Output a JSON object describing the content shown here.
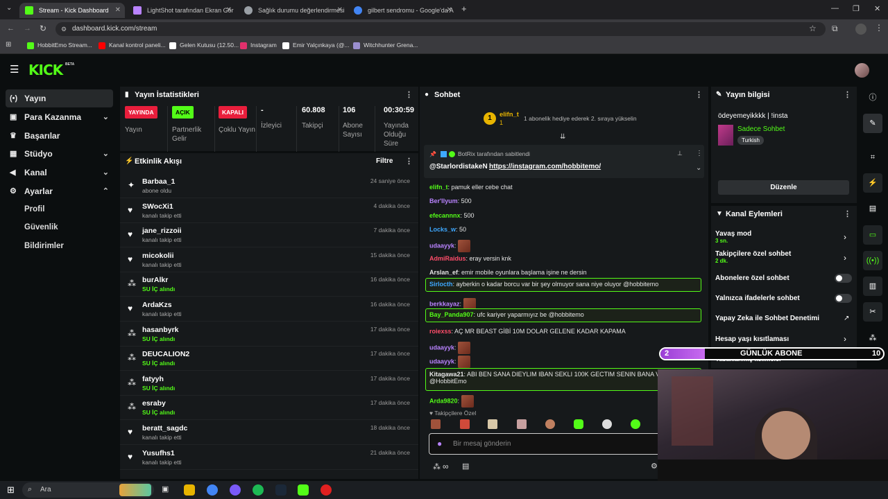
{
  "browser": {
    "tabs": [
      {
        "title": "Stream - Kick Dashboard",
        "color": "#53fc18"
      },
      {
        "title": "LightShot tarafından Ekran Gör",
        "color": "#b983ff"
      },
      {
        "title": "Sağlık durumu değerlendirmesi",
        "color": "#9aa0a6"
      },
      {
        "title": "gilbert sendromu - Google'da A",
        "color": "#4285f4"
      }
    ],
    "url": "dashboard.kick.com/stream",
    "bookmarks": [
      {
        "label": "HobbitEmo Stream...",
        "color": "#53fc18"
      },
      {
        "label": "Kanal kontrol paneli...",
        "color": "#ff0000"
      },
      {
        "label": "Gelen Kutusu (12.50...",
        "color": "#ffffff"
      },
      {
        "label": "Instagram",
        "color": "#e1306c"
      },
      {
        "label": "Emir Yalçınkaya (@...",
        "color": "#ffffff"
      },
      {
        "label": "Witchhunter Grena...",
        "color": "#9b8fd0"
      }
    ]
  },
  "header": {
    "logo": "KICK",
    "beta": "BETA"
  },
  "sidebar": {
    "items": [
      {
        "label": "Yayın",
        "icon": "broadcast-icon"
      },
      {
        "label": "Para Kazanma",
        "icon": "money-icon"
      },
      {
        "label": "Başarılar",
        "icon": "trophy-icon"
      },
      {
        "label": "Stüdyo",
        "icon": "studio-icon"
      },
      {
        "label": "Kanal",
        "icon": "channel-icon"
      },
      {
        "label": "Ayarlar",
        "icon": "settings-icon"
      }
    ],
    "sub_items": [
      "Profil",
      "Güvenlik",
      "Bildirimler"
    ]
  },
  "stats": {
    "title": "Yayın İstatistikleri",
    "cells": [
      {
        "badge": "YAYINDA",
        "label": "Yayın"
      },
      {
        "badge": "AÇIK",
        "label": "Partnerlik Gelir"
      },
      {
        "badge": "KAPALI",
        "label": "Çoklu Yayın"
      },
      {
        "value": "-",
        "label": "İzleyici"
      },
      {
        "value": "60.808",
        "label": "Takipçi"
      },
      {
        "value": "106",
        "label": "Abone Sayısı"
      },
      {
        "value": "00:30:59",
        "label": "Yayında Olduğu Süre"
      }
    ]
  },
  "activity": {
    "title": "Etkinlik Akışı",
    "filter": "Filtre",
    "items": [
      {
        "name": "Barbaa_1",
        "desc": "abone oldu",
        "time": "24 saniye önce",
        "type": "sub"
      },
      {
        "name": "SWocXi1",
        "desc": "kanalı takip etti",
        "time": "4 dakika önce",
        "type": "follow"
      },
      {
        "name": "jane_rizzoii",
        "desc": "kanalı takip etti",
        "time": "7 dakika önce",
        "type": "follow"
      },
      {
        "name": "micokolii",
        "desc": "kanalı takip etti",
        "time": "15 dakika önce",
        "type": "follow"
      },
      {
        "name": "burAlkr",
        "desc": "SU İÇ alındı",
        "time": "16 dakika önce",
        "type": "reward"
      },
      {
        "name": "ArdaKzs",
        "desc": "kanalı takip etti",
        "time": "16 dakika önce",
        "type": "follow"
      },
      {
        "name": "hasanbyrk",
        "desc": "SU İÇ alındı",
        "time": "17 dakika önce",
        "type": "reward"
      },
      {
        "name": "DEUCALION2",
        "desc": "SU İÇ alındı",
        "time": "17 dakika önce",
        "type": "reward"
      },
      {
        "name": "fatyyh",
        "desc": "SU İÇ alındı",
        "time": "17 dakika önce",
        "type": "reward"
      },
      {
        "name": "esraby",
        "desc": "SU İÇ alındı",
        "time": "17 dakika önce",
        "type": "reward"
      },
      {
        "name": "beratt_sagdc",
        "desc": "kanalı takip etti",
        "time": "18 dakika önce",
        "type": "follow"
      },
      {
        "name": "Yusufhs1",
        "desc": "kanalı takip etti",
        "time": "21 dakika önce",
        "type": "follow"
      }
    ]
  },
  "chat": {
    "title": "Sohbet",
    "top_gifter": "elifn_t",
    "top_gifter_count": "1",
    "gift_text": "1 abonelik hediye ederek 2. sıraya yükselin",
    "pinned_by": "BotRix tarafından sabitlendi",
    "pinned_user": "@StarlordistakeN",
    "pinned_link": "https://instagram.com/hobbitemo/",
    "messages": [
      {
        "user": "elifn_t",
        "color": "#53fc18",
        "text": "pamuk eller cebe chat",
        "hl": false
      },
      {
        "user": "Ber'llyum",
        "color": "#b983ff",
        "text": "500",
        "hl": false
      },
      {
        "user": "efecannnx",
        "color": "#53fc18",
        "text": "500",
        "hl": false
      },
      {
        "user": "Locks_w",
        "color": "#3ea8ff",
        "text": "50",
        "hl": false
      },
      {
        "user": "udaayyk",
        "color": "#b983ff",
        "text": "",
        "emote": true,
        "hl": false
      },
      {
        "user": "AdmiRaidus",
        "color": "#ff4d6a",
        "text": "eray versin knk",
        "hl": false
      },
      {
        "user": "Arslan_ef",
        "color": "#e6e6e6",
        "text": "emir mobile oyunlara başlama işine ne dersin",
        "hl": false
      },
      {
        "user": "Sirlocth",
        "color": "#3ea8ff",
        "text": "ayberkin o kadar borcu var bir şey olmuyor sana niye oluyor @hobbitemo",
        "hl": true
      },
      {
        "user": "berkkayaz",
        "color": "#b983ff",
        "text": "",
        "emote": true,
        "hl": false
      },
      {
        "user": "Bay_Panda907",
        "color": "#53fc18",
        "text": "ufc kariyer yaparmıyız be @hobbitemo",
        "hl": true
      },
      {
        "user": "roiexss",
        "color": "#ff4d6a",
        "text": "AÇ MR BEAST GİBİ 10M DOLAR GELENE KADAR KAPAMA",
        "hl": false
      },
      {
        "user": "udaayyk",
        "color": "#b983ff",
        "text": "",
        "emote": true,
        "hl": false
      },
      {
        "user": "udaayyk",
        "color": "#b983ff",
        "text": "",
        "emote": true,
        "hl": false
      },
      {
        "user": "Kitagawa21",
        "color": "#e6e6e6",
        "text": "ABI BEN SANA DIEYLIM IBAN SEKLI 100K GECTIM SENIN BANA VAAT",
        "text2": "@HobbitEmo",
        "hl": true
      },
      {
        "user": "Arda9820",
        "color": "#53fc18",
        "text": "",
        "emote": true,
        "hl": false
      }
    ],
    "followers_only": "Takipçilere Özel",
    "input_placeholder": "Bir mesaj gönderin"
  },
  "stream_info": {
    "title": "Yayın bilgisi",
    "stream_title": "ödeyemeyikkkk | !insta",
    "category": "Sadece Sohbet",
    "language": "Turkish",
    "edit": "Düzenle"
  },
  "channel_actions": {
    "title": "Kanal Eylemleri",
    "items": [
      {
        "label": "Yavaş mod",
        "sub": "3 sn.",
        "control": "arrow"
      },
      {
        "label": "Takipçilere özel sohbet",
        "sub": "2 dk.",
        "control": "arrow"
      },
      {
        "label": "Abonelere özel sohbet",
        "control": "toggle"
      },
      {
        "label": "Yalnızca ifadelerle sohbet",
        "control": "toggle"
      },
      {
        "label": "Yapay Zeka ile Sohbet Denetimi",
        "control": "external"
      },
      {
        "label": "Hesap yaşı kısıtlaması",
        "control": "arrow"
      },
      {
        "label": "Yasaklanmış kelimeler",
        "control": "arrow"
      }
    ]
  },
  "overlay": {
    "left_num": "2",
    "label": "GÜNLÜK ABONE",
    "right_num": "10",
    "progress": 0.2
  },
  "taskbar": {
    "search": "Ara"
  }
}
